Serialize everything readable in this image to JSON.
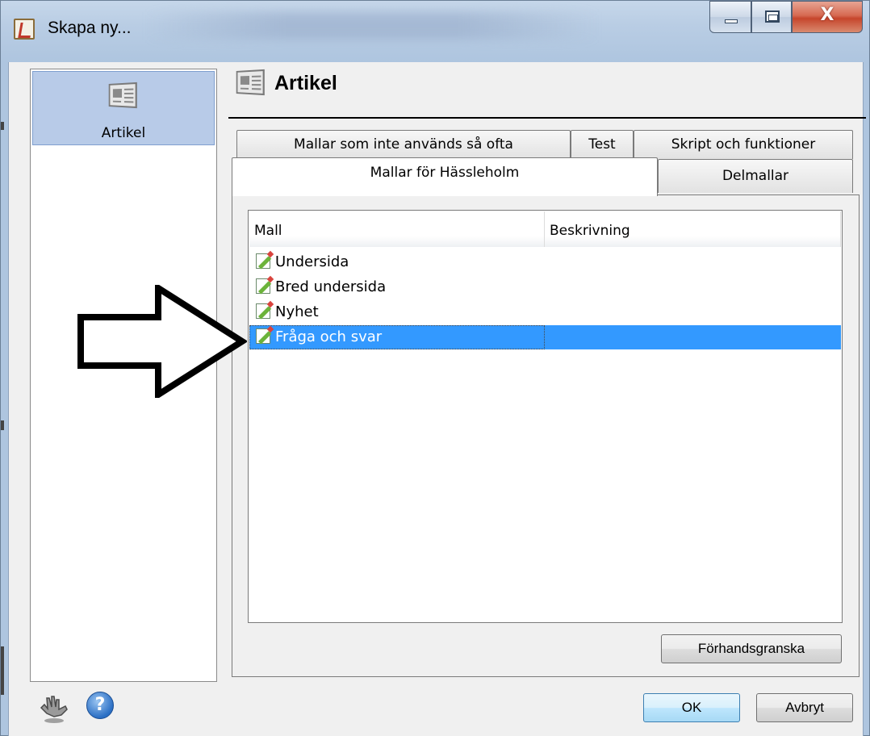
{
  "window": {
    "title": "Skapa ny...",
    "controls": {
      "close_label": "X"
    }
  },
  "sidebar": {
    "items": [
      {
        "label": "Artikel",
        "icon": "newspaper-icon",
        "selected": true
      }
    ]
  },
  "header": {
    "title": "Artikel",
    "icon": "newspaper-icon"
  },
  "tabs": {
    "back_row": [
      {
        "label": "Mallar som inte används så ofta"
      },
      {
        "label": "Test"
      },
      {
        "label": "Skript och funktioner"
      }
    ],
    "front_row": [
      {
        "label": "Mallar för Hässleholm",
        "selected": true
      },
      {
        "label": "Delmallar"
      }
    ]
  },
  "table": {
    "columns": [
      "Mall",
      "Beskrivning"
    ],
    "rows": [
      {
        "name": "Undersida",
        "description": ""
      },
      {
        "name": "Bred undersida",
        "description": ""
      },
      {
        "name": "Nyhet",
        "description": ""
      },
      {
        "name": "Fråga och svar",
        "description": "",
        "selected": true
      }
    ],
    "selection_color": "#3399ff"
  },
  "buttons": {
    "preview": "Förhandsgranska",
    "ok": "OK",
    "cancel": "Avbryt"
  },
  "footer_icons": [
    "hand-icon",
    "help-icon"
  ],
  "help_glyph": "?"
}
